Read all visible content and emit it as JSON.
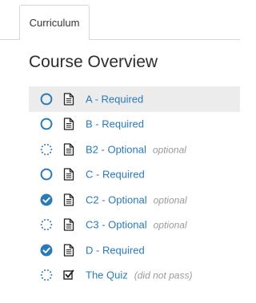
{
  "tabs": [
    {
      "label": "Curriculum"
    }
  ],
  "page_title": "Course Overview",
  "colors": {
    "accent": "#2a7ab8",
    "muted": "#9a9a9a",
    "highlight_row": "#ececec",
    "border": "#d6d6d6"
  },
  "items": [
    {
      "label": "A - Required",
      "note": "",
      "status": "incomplete",
      "type_icon": "document-icon",
      "highlighted": true
    },
    {
      "label": "B - Required",
      "note": "",
      "status": "incomplete",
      "type_icon": "document-icon",
      "highlighted": false
    },
    {
      "label": "B2 - Optional",
      "note": "optional",
      "status": "optional",
      "type_icon": "document-icon",
      "highlighted": false
    },
    {
      "label": "C - Required",
      "note": "",
      "status": "incomplete",
      "type_icon": "document-icon",
      "highlighted": false
    },
    {
      "label": "C2 - Optional",
      "note": "optional",
      "status": "complete",
      "type_icon": "document-icon",
      "highlighted": false
    },
    {
      "label": "C3 - Optional",
      "note": "optional",
      "status": "optional",
      "type_icon": "document-icon",
      "highlighted": false
    },
    {
      "label": "D - Required",
      "note": "",
      "status": "complete",
      "type_icon": "document-icon",
      "highlighted": false
    },
    {
      "label": "The Quiz",
      "note": "(did not pass)",
      "status": "optional",
      "type_icon": "quiz-checkbox-icon",
      "highlighted": false
    }
  ]
}
